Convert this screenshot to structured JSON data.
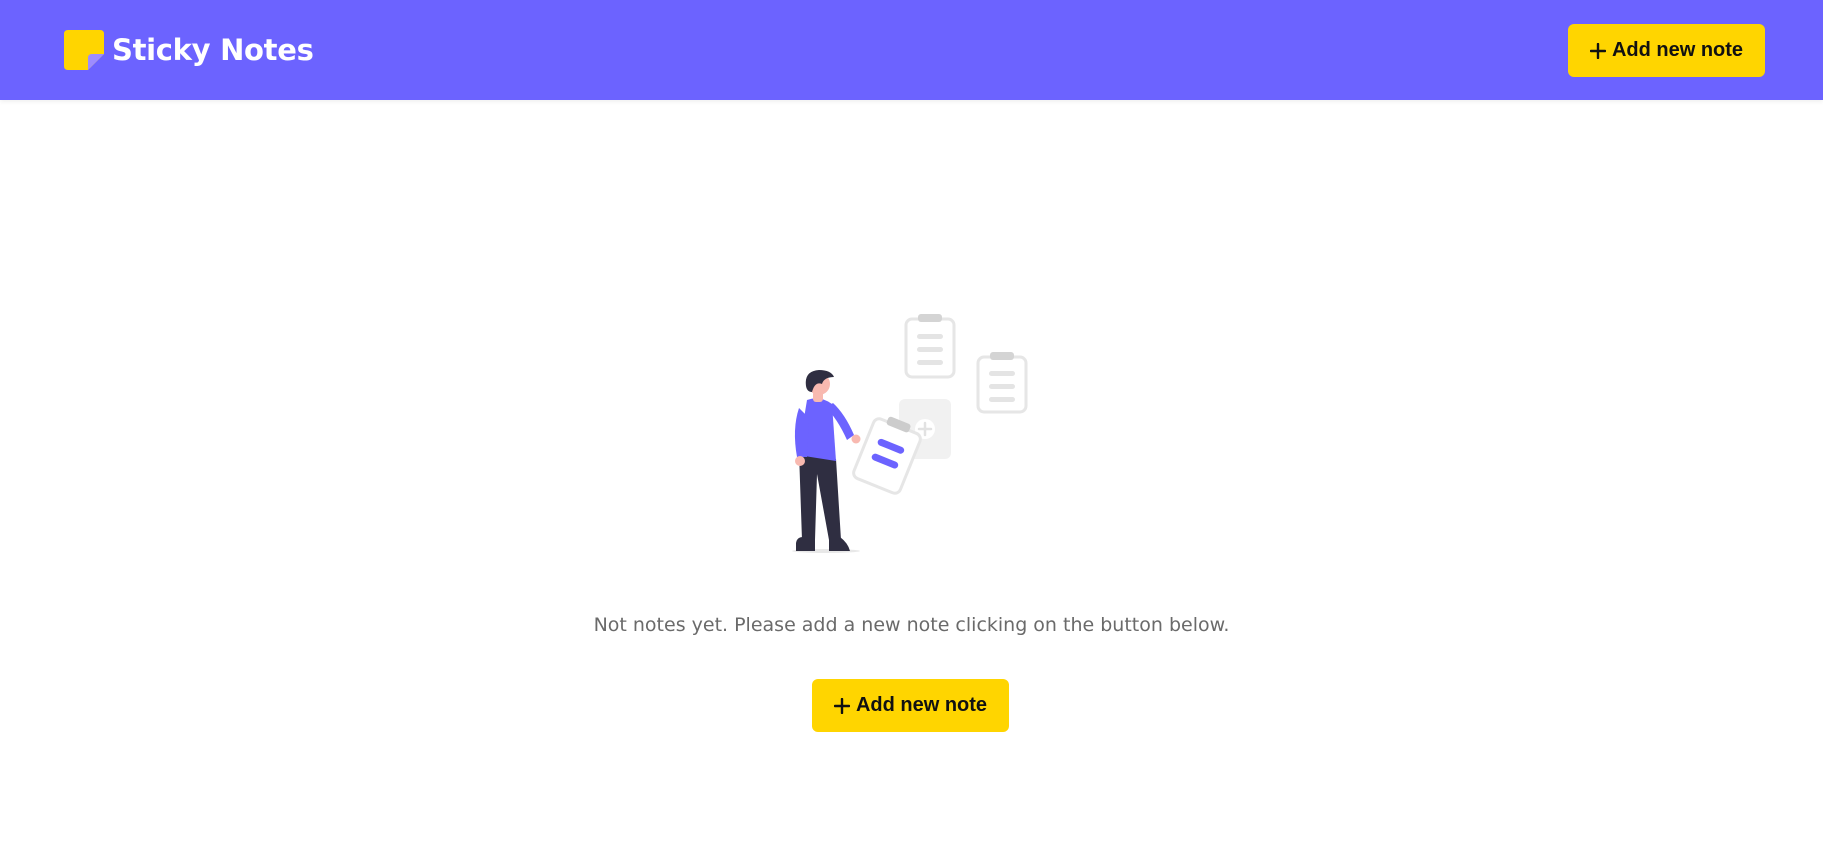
{
  "header": {
    "app_title": "Sticky Notes",
    "add_button_label": "Add new note",
    "logo_icon": "sticky-note-icon"
  },
  "empty_state": {
    "message": "Not notes yet. Please add a new note clicking on the button below.",
    "add_button_label": "Add new note",
    "illustration": "person-with-clipboards-illustration"
  },
  "colors": {
    "header_background": "#6c63ff",
    "button_background": "#ffd500",
    "button_text": "#111111",
    "message_text": "#6a6a6a"
  }
}
